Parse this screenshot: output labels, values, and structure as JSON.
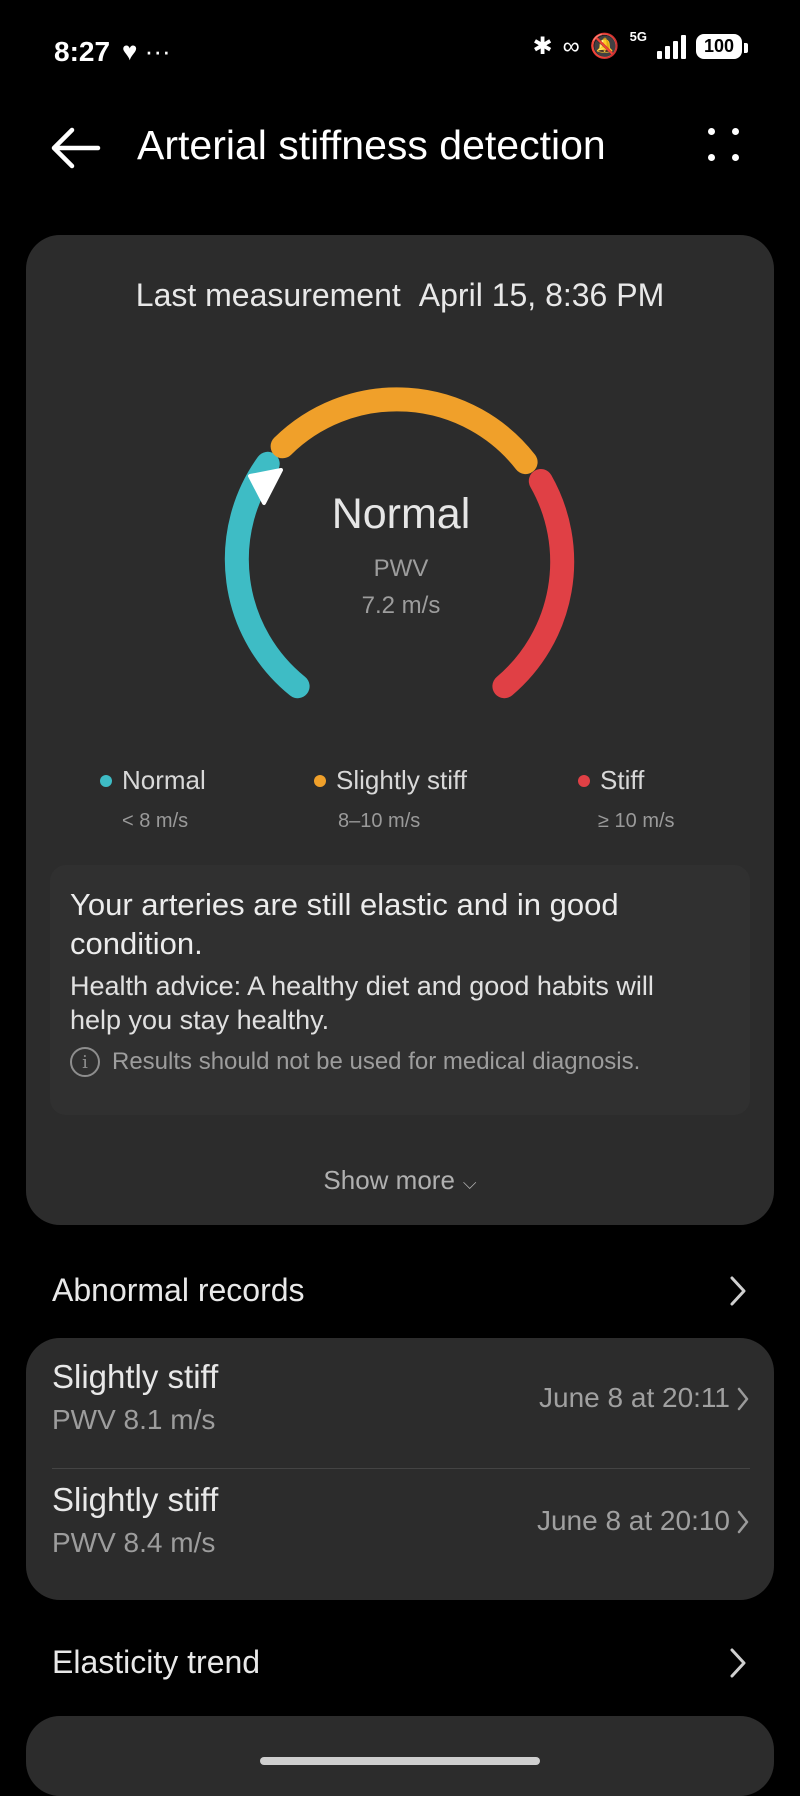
{
  "status_bar": {
    "time": "8:27",
    "left_icons": [
      "health-app-icon",
      "more-notifications-icon"
    ],
    "right_icons": [
      "bluetooth-icon",
      "link-icon",
      "mute-icon",
      "signal-icon"
    ],
    "network": "5G",
    "battery": "100"
  },
  "header": {
    "title": "Arterial stiffness detection"
  },
  "measurement": {
    "label": "Last measurement",
    "datetime": "April 15, 8:36 PM",
    "status": "Normal",
    "metric_label": "PWV",
    "metric_value": "7.2 m/s",
    "colors": {
      "normal": "#3ebcc5",
      "slightly_stiff": "#f0a02a",
      "stiff": "#e04045"
    }
  },
  "legend": [
    {
      "name": "Normal",
      "range": "< 8 m/s",
      "color": "#3ebcc5"
    },
    {
      "name": "Slightly stiff",
      "range": "8–10 m/s",
      "color": "#f0a02a"
    },
    {
      "name": "Stiff",
      "range": "≥ 10 m/s",
      "color": "#e04045"
    }
  ],
  "advice": {
    "title": "Your arteries are still elastic and in good condition.",
    "text": "Health advice: A healthy diet and good habits will help you stay healthy.",
    "disclaimer": "Results should not be used for medical diagnosis."
  },
  "show_more": "Show more",
  "abnormal_records": {
    "title": "Abnormal records",
    "items": [
      {
        "status": "Slightly stiff",
        "pwv": "PWV 8.1 m/s",
        "date": "June 8 at 20:11"
      },
      {
        "status": "Slightly stiff",
        "pwv": "PWV 8.4 m/s",
        "date": "June 8 at 20:10"
      }
    ]
  },
  "elasticity_trend": {
    "title": "Elasticity trend"
  }
}
